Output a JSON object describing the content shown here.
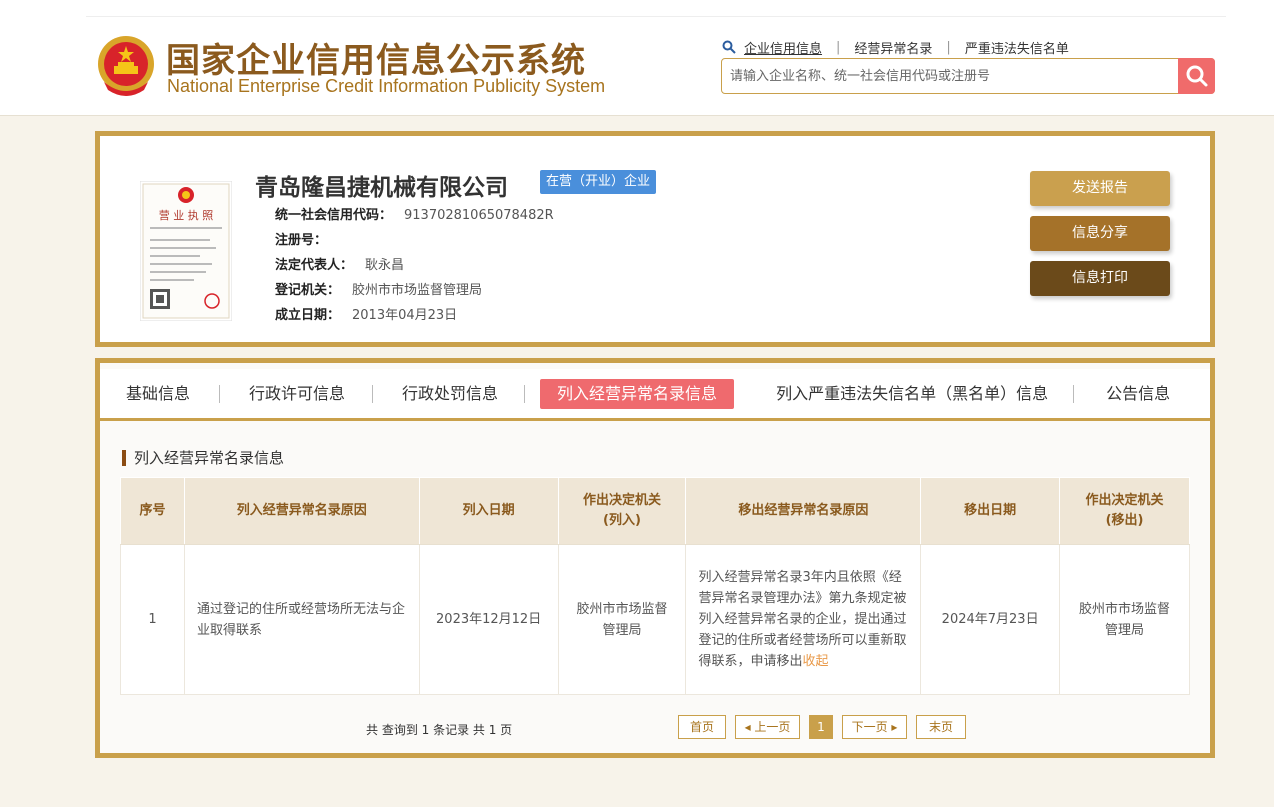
{
  "header": {
    "title_cn": "国家企业信用信息公示系统",
    "title_en": "National Enterprise Credit Information Publicity System",
    "links": [
      "企业信用信息",
      "经营异常名录",
      "严重违法失信名单"
    ],
    "search_placeholder": "请输入企业名称、统一社会信用代码或注册号",
    "colors": {
      "brand": "#8b5a1e",
      "accent": "#c9a04b",
      "search_btn": "#f06b6b"
    }
  },
  "company": {
    "name": "青岛隆昌捷机械有限公司",
    "status": "在营（开业）企业",
    "license_image_title": "营业执照",
    "fields": [
      {
        "label": "统一社会信用代码：",
        "value": "91370281065078482R"
      },
      {
        "label": "注册号：",
        "value": ""
      },
      {
        "label": "法定代表人：",
        "value": "耿永昌"
      },
      {
        "label": "登记机关：",
        "value": "胶州市市场监督管理局"
      },
      {
        "label": "成立日期：",
        "value": "2013年04月23日"
      }
    ],
    "buttons": {
      "report": "发送报告",
      "share": "信息分享",
      "print": "信息打印"
    }
  },
  "tabs": [
    "基础信息",
    "行政许可信息",
    "行政处罚信息",
    "列入经营异常名录信息",
    "列入严重违法失信名单（黑名单）信息",
    "公告信息"
  ],
  "active_tab": 3,
  "section": {
    "title": "列入经营异常名录信息",
    "headers": [
      "序号",
      "列入经营异常名录原因",
      "列入日期",
      "作出决定机关\n(列入)",
      "移出经营异常名录原因",
      "移出日期",
      "作出决定机关\n(移出)"
    ],
    "rows": [
      {
        "index": "1",
        "reason": "通过登记的住所或经营场所无法与企业取得联系",
        "date_in": "2023年12月12日",
        "authority_in": "胶州市市场监督管理局",
        "reason_out": "列入经营异常名录3年内且依照《经营异常名录管理办法》第九条规定被列入经营异常名录的企业，提出通过登记的住所或者经营场所可以重新取得联系，申请移出",
        "collapse": "收起",
        "date_out": "2024年7月23日",
        "authority_out": "胶州市市场监督管理局"
      }
    ]
  },
  "pager": {
    "info": "共 查询到 1 条记录 共 1 页",
    "first": "首页",
    "prev": "◂ 上一页",
    "current": "1",
    "next": "下一页 ▸",
    "last": "末页"
  }
}
